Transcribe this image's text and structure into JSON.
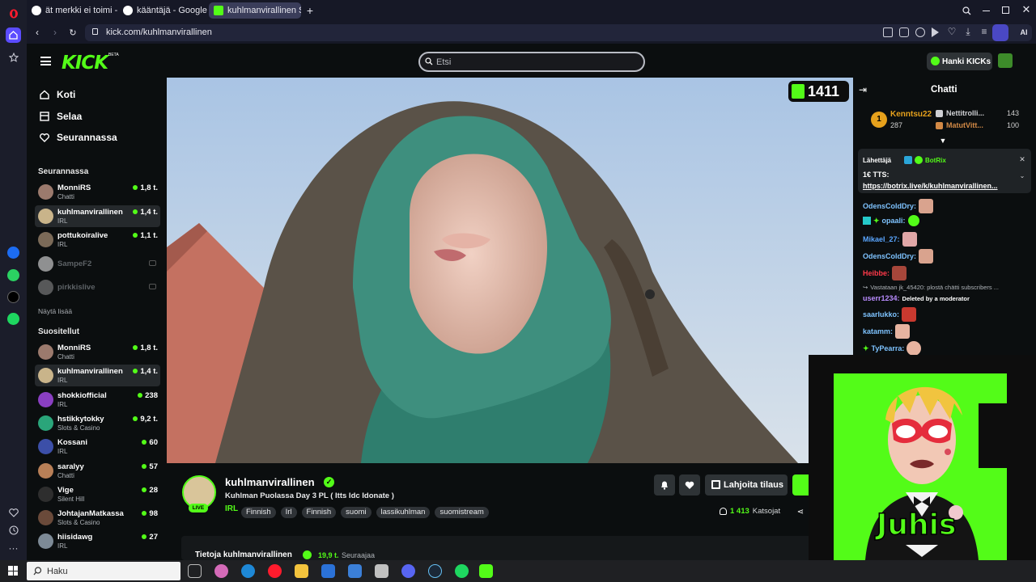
{
  "browser": {
    "tabs": [
      {
        "title": "ät merkki ei toimi - Google"
      },
      {
        "title": "kääntäjä - Google-haku"
      },
      {
        "title": "kuhlmanvirallinen Stre"
      }
    ],
    "url": "kick.com/kuhlmanvirallinen"
  },
  "kick": {
    "logo": "KICK",
    "beta": "BETA",
    "search_placeholder": "Etsi",
    "kicks_button": "Hanki KICKs",
    "nav": {
      "home": "Koti",
      "browse": "Selaa",
      "following": "Seurannassa"
    },
    "following_title": "Seurannassa",
    "following": [
      {
        "name": "MonniRS",
        "category": "Chatti",
        "viewers": "1,8 t.",
        "live": true
      },
      {
        "name": "kuhlmanvirallinen",
        "category": "IRL",
        "viewers": "1,4 t.",
        "live": true
      },
      {
        "name": "pottukoiralive",
        "category": "IRL",
        "viewers": "1,1 t.",
        "live": true
      },
      {
        "name": "SampeF2",
        "category": "",
        "viewers": "",
        "live": false
      },
      {
        "name": "pirkkislive",
        "category": "",
        "viewers": "",
        "live": false
      }
    ],
    "show_more": "Näytä lisää",
    "recommended_title": "Suositellut",
    "recommended": [
      {
        "name": "MonniRS",
        "category": "Chatti",
        "viewers": "1,8 t."
      },
      {
        "name": "kuhlmanvirallinen",
        "category": "IRL",
        "viewers": "1,4 t."
      },
      {
        "name": "shokkiofficial",
        "category": "IRL",
        "viewers": "238"
      },
      {
        "name": "hstikkytokky",
        "category": "Slots & Casino",
        "viewers": "9,2 t."
      },
      {
        "name": "Kossani",
        "category": "IRL",
        "viewers": "60"
      },
      {
        "name": "saralyy",
        "category": "Chatti",
        "viewers": "57"
      },
      {
        "name": "Vige",
        "category": "Silent Hill",
        "viewers": "28"
      },
      {
        "name": "JohtajanMatkassa",
        "category": "Slots & Casino",
        "viewers": "98"
      },
      {
        "name": "hiisidawg",
        "category": "IRL",
        "viewers": "27"
      }
    ],
    "video_viewers": "1411",
    "stream": {
      "channel": "kuhlmanvirallinen",
      "title": "Kuhlman Puolassa Day 3 PL ( Itts Idc Idonate )",
      "live_label": "LIVE",
      "category": "IRL",
      "tags": [
        "Finnish",
        "Irl",
        "Finnish",
        "suomi",
        "lassikuhlman",
        "suomistream"
      ],
      "gift_button": "Lahjoita tilaus",
      "viewer_count": "1 413",
      "viewer_label": "Katsojat",
      "about_label": "Tietoja kuhlmanvirallinen",
      "followers": "19,9 t.",
      "followers_label": "Seuraajaa"
    }
  },
  "chat": {
    "title": "Chatti",
    "leaders": [
      {
        "name": "Kenntsu22",
        "amount": "287"
      },
      {
        "name": "Nettitrolli...",
        "amount": "143"
      },
      {
        "name": "MatutVitt...",
        "amount": "100"
      }
    ],
    "pinned": {
      "sender_label": "Lähettäjä",
      "sender": "BotRix",
      "line1": "1€ TTS:",
      "line2": "https://botrix.live/k/kuhlmanvirallinen..."
    },
    "messages": [
      {
        "user": "OdensColdDry:",
        "color": "#7ec3ff"
      },
      {
        "user": "opaali:",
        "color": "#7ec3ff"
      },
      {
        "user": "Mikael_27:",
        "color": "#5aa6ff"
      },
      {
        "user": "OdensColdDry:",
        "color": "#7ec3ff"
      },
      {
        "user": "Heibbe:",
        "color": "#ff3a4a"
      },
      {
        "user": "userr1234:",
        "color": "#b98cff",
        "text": "Deleted by a moderator"
      },
      {
        "user": "saarlukko:",
        "color": "#7ec3ff"
      },
      {
        "user": "katamm:",
        "color": "#7ec3ff"
      },
      {
        "user": "TyPearra:",
        "color": "#7ec3ff"
      }
    ],
    "reply_line": "Vastataan jk_45420: plostä chätti subscribers ..."
  },
  "overlay": {
    "text": "Juhis"
  },
  "taskbar": {
    "search_placeholder": "Haku"
  }
}
